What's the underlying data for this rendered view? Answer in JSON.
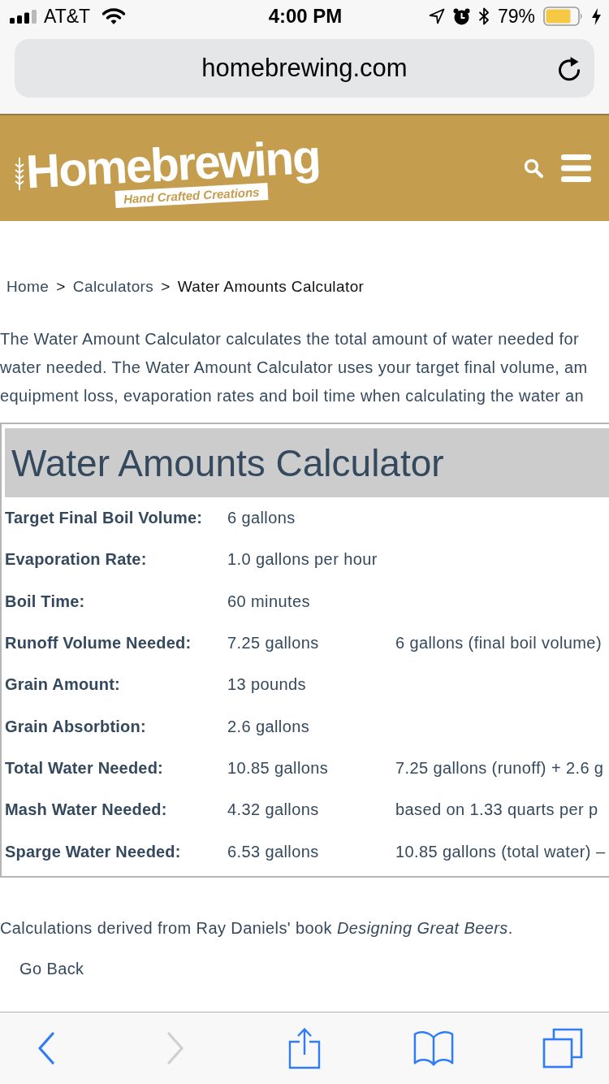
{
  "status_bar": {
    "carrier": "AT&T",
    "time": "4:00 PM",
    "battery": "79%"
  },
  "address_bar": {
    "url": "homebrewing.com"
  },
  "site_header": {
    "logo": {
      "name": "Homebrewing",
      "tagline": "Hand Crafted Creations"
    }
  },
  "breadcrumb": [
    {
      "kind": "link",
      "text": "Home"
    },
    {
      "kind": "separator",
      "text": ">"
    },
    {
      "kind": "link",
      "text": "Calculators"
    },
    {
      "kind": "separator",
      "text": ">"
    },
    {
      "kind": "current",
      "text": "Water Amounts Calculator"
    }
  ],
  "intro": {
    "lines": [
      "The Water Amount Calculator calculates the total amount of water needed for",
      "water needed. The Water Amount Calculator uses your target final volume, am",
      "equipment loss, evaporation rates and boil time when calculating the water an"
    ]
  },
  "calculator": {
    "title": "Water Amounts Calculator",
    "rows": [
      {
        "label": "Target Final Boil Volume:",
        "value": "6 gallons"
      },
      {
        "label": "Evaporation Rate:",
        "value": "1.0 gallons per hour"
      },
      {
        "label": "Boil Time:",
        "value": "60 minutes"
      },
      {
        "label": "Runoff Volume Needed:",
        "value": "7.25 gallons",
        "note": "6 gallons (final boil volume)"
      },
      {
        "label": "Grain Amount:",
        "value": "13 pounds"
      },
      {
        "label": "Grain Absorbtion:",
        "value": "2.6 gallons"
      },
      {
        "label": "Total Water Needed:",
        "value": "10.85 gallons",
        "note": "7.25 gallons (runoff) + 2.6 g"
      },
      {
        "label": "Mash Water Needed:",
        "value": "4.32 gallons",
        "note": "based on 1.33 quarts per p"
      },
      {
        "label": "Sparge Water Needed:",
        "value": "6.53 gallons",
        "note": "10.85 gallons (total water) –"
      }
    ]
  },
  "footnote": {
    "text": "Calculations derived from Ray Daniels' book *Designing Great Beers*."
  },
  "go_back": {
    "label": "Go Back"
  },
  "toolbar": {
    "buttons": [
      {
        "kind": "back",
        "disabled": false
      },
      {
        "kind": "forward",
        "disabled": true
      },
      {
        "kind": "share",
        "disabled": false
      },
      {
        "kind": "bookmarks",
        "disabled": false
      },
      {
        "kind": "tabs",
        "disabled": false
      }
    ]
  }
}
